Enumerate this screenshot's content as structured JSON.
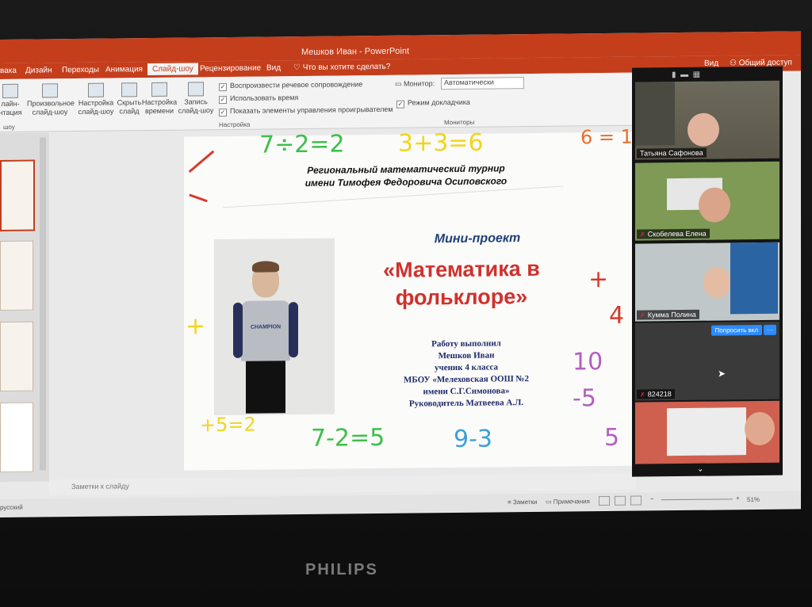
{
  "window": {
    "title": "Мешков Иван - PowerPoint"
  },
  "ribbon_tabs": [
    "вака",
    "Дизайн",
    "Переходы",
    "Анимация",
    "Слайд-шоу",
    "Рецензирование",
    "Вид",
    "Что вы хотите сделать?"
  ],
  "ribbon_right": {
    "view": "Вид",
    "share": "Общий доступ"
  },
  "ribbon": {
    "btn_online": "лайн-\nнтация",
    "btn_custom": "Произвольное\nслайд-шоу",
    "btn_setup": "Настройка\nслайд-шоу",
    "btn_hide": "Скрыть\nслайд",
    "btn_timing": "Настройка\nвремени",
    "btn_record": "Запись\nслайд-шоу",
    "chk_narration": "Воспроизвести речевое сопровождение",
    "chk_timings": "Использовать время",
    "chk_controls": "Показать элементы управления проигрывателем",
    "group_setup": "Настройка",
    "group_start": "шоу",
    "monitor_label": "Монитор:",
    "monitor_value": "Автоматически",
    "presenter_view": "Режим докладчика",
    "group_monitors": "Мониторы"
  },
  "slide": {
    "header_line1": "Региональный математический турнир",
    "header_line2": "имени Тимофея Федоровича Осиповского",
    "subtitle": "Мини-проект",
    "title_line1": "«Математика в",
    "title_line2": "фольклоре»",
    "info_lines": [
      "Работу выполнил",
      "Мешков  Иван",
      "ученик 4 класса",
      "МБОУ «Мелеховская ООШ №2",
      "имени С.Г.Симонова»",
      "Руководитель Матвеева А.Л."
    ],
    "shirt_text": "CHAMPION",
    "doodles": [
      "7÷2=2",
      "3+3=6",
      "6 = 1",
      "7-2=5",
      "9-3",
      "10",
      "-5",
      "5",
      "+",
      "4",
      "+5=2",
      "+"
    ]
  },
  "notes_placeholder": "Заметки к слайду",
  "status": {
    "left": "русский",
    "notes": "Заметки",
    "comments": "Примечания",
    "zoom": "51%"
  },
  "zoom_call": {
    "participants": [
      {
        "name": "Татьяна Сафонова",
        "muted": false
      },
      {
        "name": "Скобелева Елена",
        "muted": true
      },
      {
        "name": "Кумма Полина",
        "muted": true
      },
      {
        "name": "824218",
        "muted": true
      }
    ],
    "ask_button": "Попросить вкл",
    "more_button": "···"
  },
  "monitor_brand": "PHILIPS",
  "colors": {
    "accent": "#c43e1c",
    "title_red": "#d0312d",
    "subtitle_blue": "#1f3f7a",
    "zoom_blue": "#2d8cff"
  }
}
